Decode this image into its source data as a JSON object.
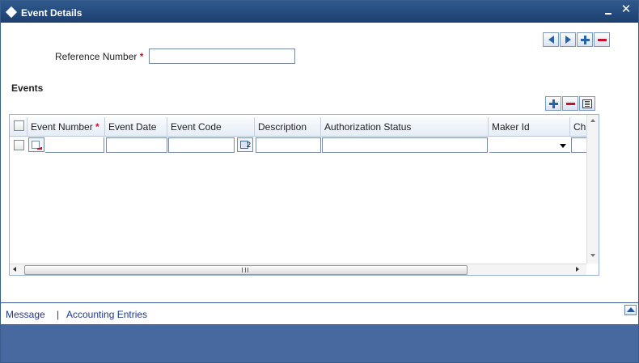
{
  "window": {
    "title": "Event Details",
    "minimize_icon": "minimize-icon",
    "close_label": "✕"
  },
  "nav_buttons": [
    "previous-icon",
    "next-icon",
    "add-icon",
    "remove-icon"
  ],
  "form": {
    "reference_label": "Reference Number",
    "reference_required": "*",
    "reference_value": ""
  },
  "events": {
    "title": "Events",
    "toolbar": [
      "add-row-icon",
      "delete-row-icon",
      "single-view-icon"
    ],
    "columns": [
      {
        "label": "Event Number",
        "required": "*"
      },
      {
        "label": "Event Date"
      },
      {
        "label": "Event Code"
      },
      {
        "label": "Description"
      },
      {
        "label": "Authorization Status"
      },
      {
        "label": "Maker Id"
      },
      {
        "label": "Ch"
      }
    ],
    "rows": [
      {
        "event_number": "",
        "event_date": "",
        "event_code": "",
        "lov_label": "2",
        "description": "",
        "authorization_status": "",
        "maker_id": "",
        "checker": ""
      }
    ],
    "scrollbar_grip": "III"
  },
  "footer": {
    "links": [
      "Message",
      "Accounting Entries"
    ],
    "separator": "|"
  },
  "colors": {
    "title_bar": "#1c3f6e",
    "footer_bar": "#4869a0",
    "required": "#c8102e",
    "link": "#1e3a8a"
  }
}
